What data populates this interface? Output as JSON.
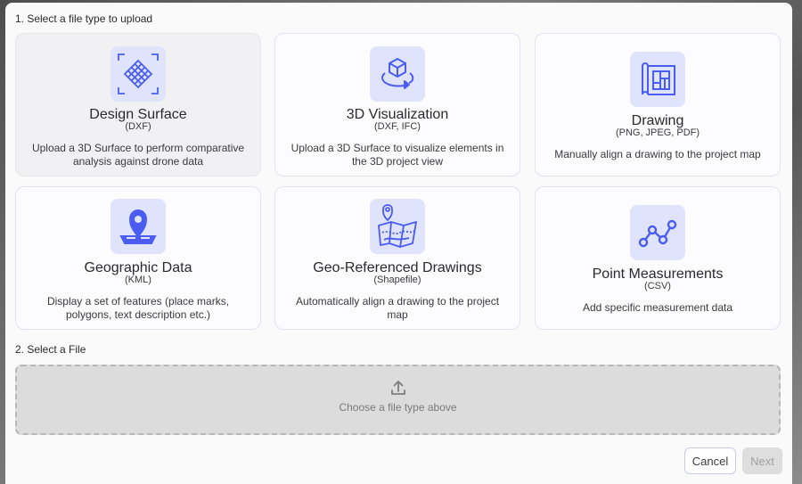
{
  "step1": {
    "title": "1. Select a file type to upload"
  },
  "cards": [
    {
      "title": "Design Surface",
      "subtitle": "(DXF)",
      "description": "Upload a 3D Surface to perform comparative analysis against drone data",
      "icon": "surface-mesh-icon",
      "selected": true
    },
    {
      "title": "3D Visualization",
      "subtitle": "(DXF, IFC)",
      "description": "Upload a 3D Surface to visualize elements in the 3D project view",
      "icon": "cube-rotate-icon"
    },
    {
      "title": "Drawing",
      "subtitle": "(PNG, JPEG, PDF)",
      "description": "Manually align a drawing to the project map",
      "icon": "blueprint-icon"
    },
    {
      "title": "Geographic Data",
      "subtitle": "(KML)",
      "description": "Display a set of features (place marks, polygons, text description etc.)",
      "icon": "map-pin-icon"
    },
    {
      "title": "Geo-Referenced Drawings",
      "subtitle": "(Shapefile)",
      "description": "Automatically align a drawing to the project map",
      "icon": "folded-map-icon"
    },
    {
      "title": "Point Measurements",
      "subtitle": "(CSV)",
      "description": "Add specific measurement data",
      "icon": "line-chart-icon"
    }
  ],
  "step2": {
    "title": "2. Select a File"
  },
  "dropzone": {
    "hint": "Choose a file type above",
    "icon": "upload-icon"
  },
  "buttons": {
    "cancel": "Cancel",
    "next": "Next"
  },
  "colors": {
    "accent": "#4a5df0",
    "tile": "#dfe3fb"
  }
}
